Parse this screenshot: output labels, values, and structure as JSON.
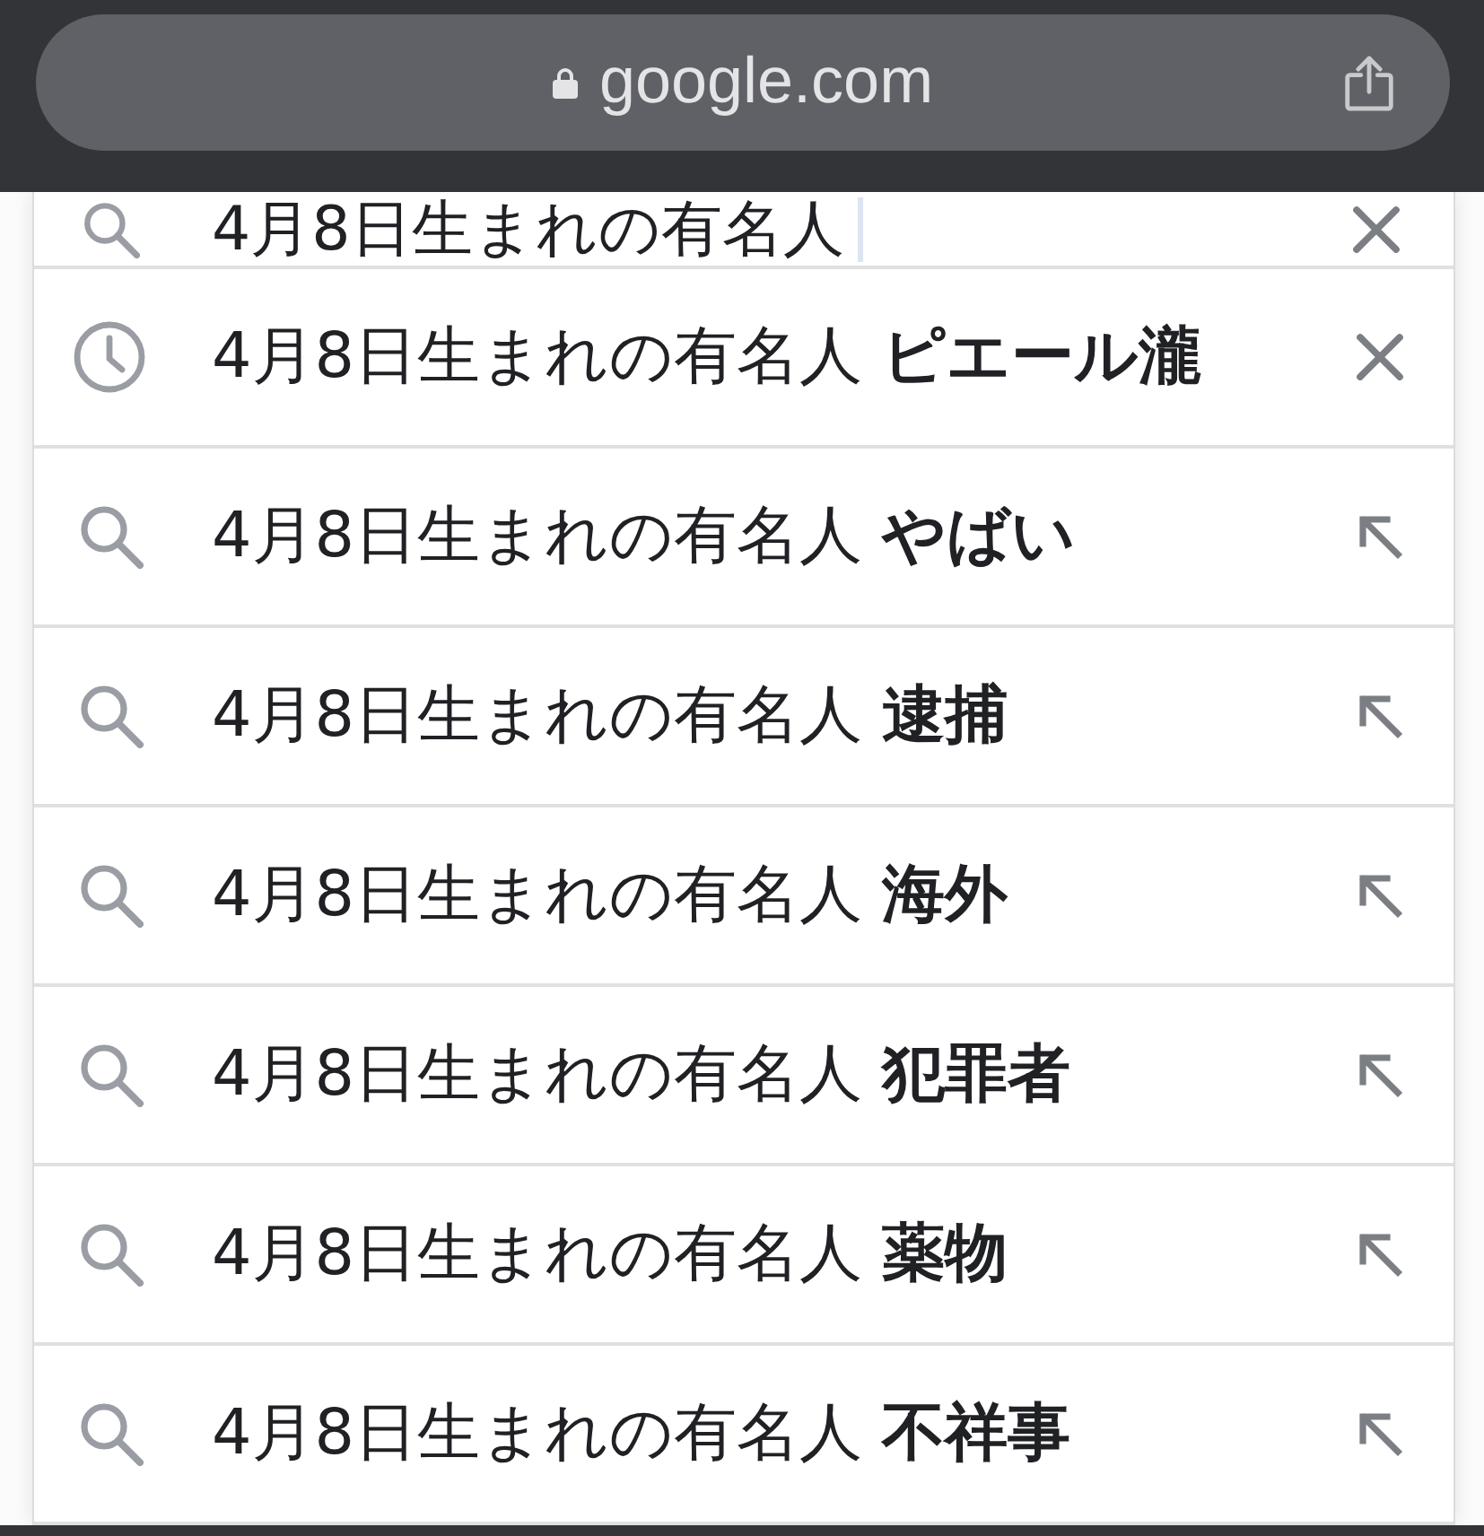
{
  "browser_bar": {
    "url": "google.com"
  },
  "search_box": {
    "value": "4月8日生まれの有名人"
  },
  "suggestions": [
    {
      "kind": "history",
      "text": "4月8日生まれの有名人 **ピエール瀧**"
    },
    {
      "kind": "search",
      "text": "4月8日生まれの有名人 **やばい**"
    },
    {
      "kind": "search",
      "text": "4月8日生まれの有名人 **逮捕**"
    },
    {
      "kind": "search",
      "text": "4月8日生まれの有名人 **海外**"
    },
    {
      "kind": "search",
      "text": "4月8日生まれの有名人 **犯罪者**"
    },
    {
      "kind": "search",
      "text": "4月8日生まれの有名人 **薬物**"
    },
    {
      "kind": "search",
      "text": "4月8日生まれの有名人 **不祥事**"
    }
  ]
}
